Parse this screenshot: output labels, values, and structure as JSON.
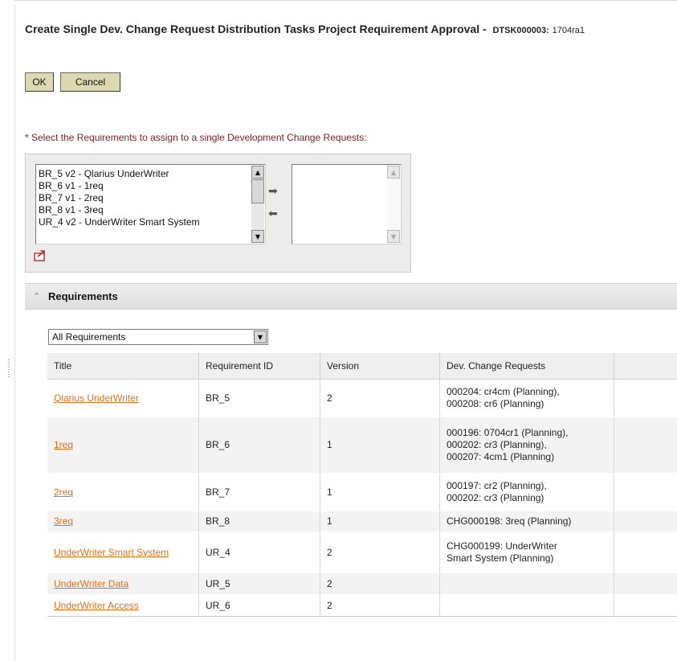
{
  "page": {
    "title": "Create Single Dev. Change Request Distribution Tasks Project Requirement Approval -",
    "task_id": "DTSK000003:",
    "task_number": "1704ra1"
  },
  "buttons": {
    "ok": "OK",
    "cancel": "Cancel"
  },
  "instruction": "* Select the Requirements to assign to a single Development Change Requests:",
  "available_list": [
    "BR_5 v2 - Qlarius UnderWriter",
    "BR_6 v1 - 1req",
    "BR_7 v1 - 2req",
    "BR_8 v1 - 3req",
    "UR_4 v2 - UnderWriter Smart System"
  ],
  "selected_list": [],
  "section": {
    "label": "Requirements"
  },
  "filter": {
    "value": "All Requirements"
  },
  "table": {
    "columns": [
      "Title",
      "Requirement ID",
      "Version",
      "Dev. Change Requests"
    ],
    "rows": [
      {
        "title": "Qlarius UnderWriter",
        "id": "BR_5",
        "version": "2",
        "dcr": [
          "000204: cr4cm (Planning),",
          "000208: cr6 (Planning)"
        ]
      },
      {
        "title": "1req",
        "id": "BR_6",
        "version": "1",
        "dcr": [
          "000196: 0704cr1 (Planning),",
          "000202: cr3 (Planning),",
          "000207: 4cm1 (Planning)"
        ]
      },
      {
        "title": "2req",
        "id": "BR_7",
        "version": "1",
        "dcr": [
          "000197: cr2 (Planning),",
          "000202: cr3 (Planning)"
        ]
      },
      {
        "title": "3req",
        "id": "BR_8",
        "version": "1",
        "dcr": [
          "CHG000198: 3req (Planning)"
        ]
      },
      {
        "title": "UnderWriter Smart System",
        "id": "UR_4",
        "version": "2",
        "dcr": [
          "CHG000199: UnderWriter",
          "Smart System (Planning)"
        ]
      },
      {
        "title": "UnderWriter Data",
        "id": "UR_5",
        "version": "2",
        "dcr": []
      },
      {
        "title": "UnderWriter Access",
        "id": "UR_6",
        "version": "2",
        "dcr": []
      }
    ]
  },
  "colors": {
    "link": "#e0701a",
    "instruction": "#8a1c1c",
    "button": "#dcd8b2"
  },
  "icons": [
    "move-right-arrow-icon",
    "move-left-arrow-icon",
    "export-icon",
    "collapse-chevron-icon",
    "dropdown-arrow-icon"
  ]
}
